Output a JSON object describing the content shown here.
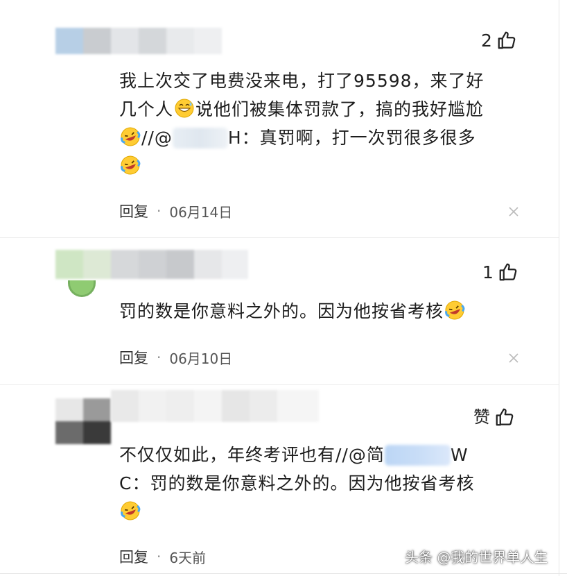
{
  "comments": [
    {
      "likes": "2",
      "lines": [
        "我上次交了电费没来电，打了95598，来了好",
        "几个人",
        "说他们被集体罚款了，搞的我好尴尬",
        "//@",
        "H：真罚啊，打一次罚很多很多"
      ],
      "reply_label": "回复",
      "date": "06月14日"
    },
    {
      "likes": "1",
      "lines": [
        "罚的数是你意料之外的。因为他按省考核"
      ],
      "reply_label": "回复",
      "date": "06月10日"
    },
    {
      "likes": "赞",
      "lines": [
        "不仅仅如此，年终考评也有//@简",
        "W",
        "C：罚的数是你意料之外的。因为他按省考核"
      ],
      "reply_label": "回复",
      "date": "6天前"
    }
  ],
  "separator_dot": "·",
  "watermark": "头条 @我的世界单人生",
  "icons": {
    "like": "thumbs-up-icon",
    "laugh": "laughing-crying-emoji-icon",
    "grin": "grinning-sweat-emoji-icon",
    "close": "close-icon"
  },
  "colors": {
    "text": "#1d1d1d",
    "meta": "#555555",
    "separator": "#ececec"
  }
}
